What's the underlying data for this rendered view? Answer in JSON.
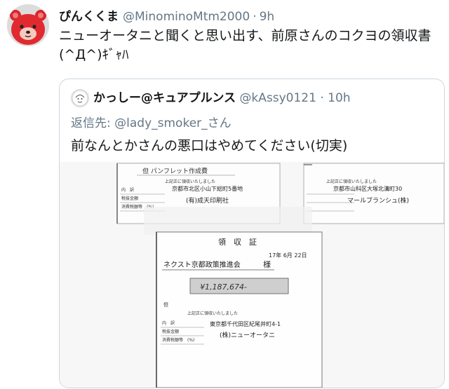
{
  "tweet": {
    "display_name": "ぴんくくま",
    "handle": "@MinominoMtm2000",
    "separator": "·",
    "time": "9h",
    "text_line1": "ニューオータニと聞くと思い出す、前原さんのコクヨの領収書",
    "text_line2": "(^Д^)ｷﾞｬﾊ"
  },
  "quote": {
    "display_name": "かっしー@キュアプルンス",
    "handle": "@kAssy0121",
    "separator": "·",
    "time": "10h",
    "reply_prefix": "返信先:",
    "reply_to": "@lady_smoker_さん",
    "text": "前なんとかさんの悪口はやめてください(切実)"
  },
  "receipts": {
    "top_left": {
      "note": "但 パンフレット作成費",
      "received": "上記正に領収いたしました",
      "label_inner": "内　訳",
      "label_tax_excluded": "税抜金額",
      "label_tax": "消費税額等　(%)",
      "address": "京都市北区小山下総町5番地",
      "company": "(有)成天印刷社"
    },
    "top_right": {
      "received": "上記正に領収いたしました",
      "address": "京都市山科区大塚北溝町30",
      "company": "マールブランシュ(株)"
    },
    "main": {
      "title": "領　収　証",
      "date": "17年 6月 22日",
      "addressee": "ネクスト京都政策推進会",
      "honorific": "様",
      "amount": "¥1,187,674-",
      "note_prefix": "但",
      "received": "上記正に領収いたしました",
      "label_inner": "内　訳",
      "label_tax_excluded": "税抜金額",
      "label_tax": "消費税額等　(%)",
      "address": "東京都千代田区紀尾井町4-1",
      "company": "(株)ニューオータニ"
    }
  }
}
